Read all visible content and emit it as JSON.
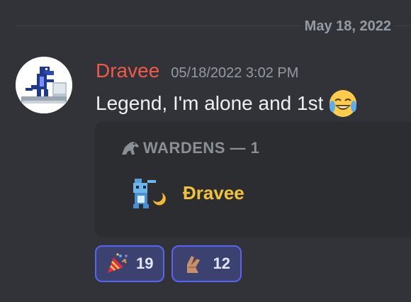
{
  "divider": {
    "date": "May 18, 2022"
  },
  "message": {
    "username": "Dravee",
    "timestamp": "05/18/2022 3:02 PM",
    "text": "Legend, I'm alone and 1st",
    "inline_emoji": "joy-emoji-icon"
  },
  "embed": {
    "title": "WARDENS — 1",
    "title_icon": "horse-icon",
    "member_name": "Đravee",
    "member_avatar": "pet-avatar-icon"
  },
  "reactions": [
    {
      "icon": "party-popper-icon",
      "count": "19"
    },
    {
      "icon": "crossed-fingers-icon",
      "count": "12"
    }
  ],
  "colors": {
    "background": "#313338",
    "username": "#f05a4a",
    "member_name": "#f0c33b",
    "reaction_border": "#5865f2"
  }
}
